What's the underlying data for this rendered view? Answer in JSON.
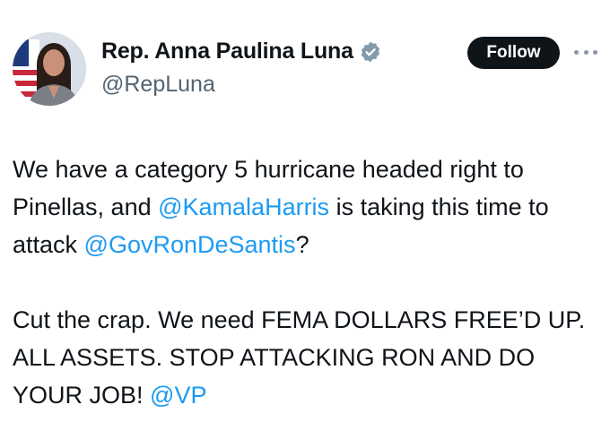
{
  "author": {
    "display_name": "Rep. Anna Paulina Luna",
    "handle": "@RepLuna",
    "verified_icon": "verified-badge-icon",
    "badge_color": "#829aab"
  },
  "actions": {
    "follow_label": "Follow",
    "more_icon": "more-options-icon"
  },
  "tweet": {
    "paragraph1": {
      "text_a": "We have a category 5 hurricane headed right to Pinellas, and ",
      "mention_a": "@KamalaHarris",
      "text_b": " is taking this time to attack ",
      "mention_b": "@GovRonDeSantis",
      "text_c": "?"
    },
    "paragraph2": {
      "text_a": "Cut the crap. We need FEMA DOLLARS FREE’D UP. ALL ASSETS. STOP ATTACKING RON AND DO YOUR JOB! ",
      "mention_a": "@VP"
    }
  },
  "colors": {
    "text": "#0f1419",
    "secondary": "#536471",
    "link": "#1d9bf0",
    "button_bg": "#0f1419"
  }
}
